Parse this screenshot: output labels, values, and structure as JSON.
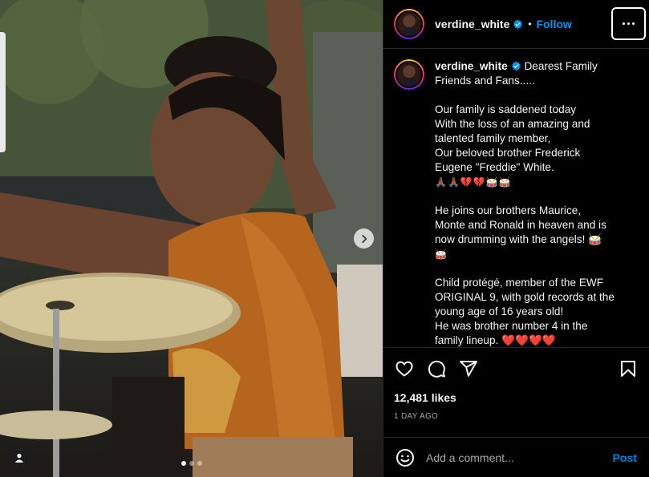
{
  "header": {
    "username": "verdine_white",
    "separator": "•",
    "follow_label": "Follow"
  },
  "caption": {
    "username": "verdine_white",
    "lines": [
      "Dearest Family",
      "Friends and Fans.....",
      "",
      "Our family is saddened today",
      "With the loss of an amazing and",
      "talented family member,",
      "Our beloved brother Frederick",
      "Eugene \"Freddie\" White.",
      "🙏🏾🙏🏾💔💔🥁🥁",
      "",
      "He joins our brothers Maurice,",
      "Monte and Ronald in heaven and is",
      "now drumming with the angels! 🥁",
      "🥁",
      "",
      "Child protégé, member of the EWF",
      "ORIGINAL 9, with gold records at the",
      "young age of 16 years old!",
      "He was brother number 4 in the",
      "family lineup. ❤️❤️❤️❤️"
    ]
  },
  "stats": {
    "likes": "12,481 likes",
    "date": "1 DAY AGO"
  },
  "comment": {
    "placeholder": "Add a comment...",
    "post_label": "Post"
  },
  "carousel": {
    "slide_count": 3,
    "active_index": 0
  },
  "colors": {
    "accent": "#0095f6",
    "background": "#000000",
    "divider": "#262626",
    "secondary_text": "#a8a8a8"
  },
  "icons": {
    "like": "heart-icon",
    "comment": "comment-icon",
    "share": "send-icon",
    "save": "bookmark-icon",
    "emoji": "smile-icon",
    "more": "more-options-icon",
    "next": "chevron-right-icon",
    "tag": "user-tag-icon",
    "verified": "verified-badge-icon"
  }
}
